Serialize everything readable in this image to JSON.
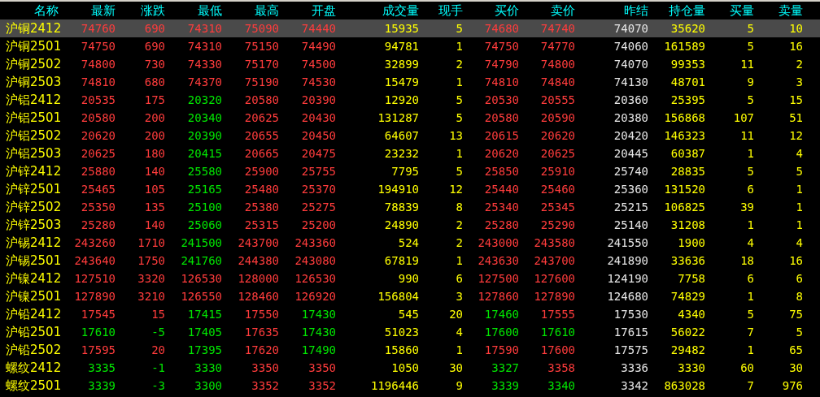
{
  "columns": [
    {
      "label": "名称",
      "kind": "name"
    },
    {
      "label": "最新",
      "kind": "price"
    },
    {
      "label": "涨跌",
      "kind": "price"
    },
    {
      "label": "最低",
      "kind": "price"
    },
    {
      "label": "最高",
      "kind": "price"
    },
    {
      "label": "开盘",
      "kind": "price"
    },
    {
      "label": "成交量",
      "kind": "volume"
    },
    {
      "label": "现手",
      "kind": "volume"
    },
    {
      "label": "买价",
      "kind": "price"
    },
    {
      "label": "卖价",
      "kind": "price"
    },
    {
      "label": "昨结",
      "kind": "ref"
    },
    {
      "label": "持仓量",
      "kind": "volume"
    },
    {
      "label": "买量",
      "kind": "volume"
    },
    {
      "label": "卖量",
      "kind": "volume"
    }
  ],
  "rows": [
    {
      "selected": true,
      "cells": [
        {
          "text": "沪铜2412"
        },
        {
          "text": "74760",
          "color": "#ff3c3c"
        },
        {
          "text": "690",
          "color": "#ff3c3c"
        },
        {
          "text": "74310",
          "color": "#ff3c3c"
        },
        {
          "text": "75090",
          "color": "#ff3c3c"
        },
        {
          "text": "74440",
          "color": "#ff3c3c"
        },
        {
          "text": "15935"
        },
        {
          "text": "5"
        },
        {
          "text": "74680",
          "color": "#ff3c3c"
        },
        {
          "text": "74740",
          "color": "#ff3c3c"
        },
        {
          "text": "74070"
        },
        {
          "text": "35620"
        },
        {
          "text": "5"
        },
        {
          "text": "10"
        }
      ]
    },
    {
      "selected": false,
      "cells": [
        {
          "text": "沪铜2501"
        },
        {
          "text": "74750",
          "color": "#ff3c3c"
        },
        {
          "text": "690",
          "color": "#ff3c3c"
        },
        {
          "text": "74310",
          "color": "#ff3c3c"
        },
        {
          "text": "75150",
          "color": "#ff3c3c"
        },
        {
          "text": "74490",
          "color": "#ff3c3c"
        },
        {
          "text": "94781"
        },
        {
          "text": "1"
        },
        {
          "text": "74750",
          "color": "#ff3c3c"
        },
        {
          "text": "74770",
          "color": "#ff3c3c"
        },
        {
          "text": "74060"
        },
        {
          "text": "161589"
        },
        {
          "text": "5"
        },
        {
          "text": "16"
        }
      ]
    },
    {
      "selected": false,
      "cells": [
        {
          "text": "沪铜2502"
        },
        {
          "text": "74800",
          "color": "#ff3c3c"
        },
        {
          "text": "730",
          "color": "#ff3c3c"
        },
        {
          "text": "74330",
          "color": "#ff3c3c"
        },
        {
          "text": "75170",
          "color": "#ff3c3c"
        },
        {
          "text": "74500",
          "color": "#ff3c3c"
        },
        {
          "text": "32899"
        },
        {
          "text": "2"
        },
        {
          "text": "74790",
          "color": "#ff3c3c"
        },
        {
          "text": "74800",
          "color": "#ff3c3c"
        },
        {
          "text": "74070"
        },
        {
          "text": "99353"
        },
        {
          "text": "11"
        },
        {
          "text": "2"
        }
      ]
    },
    {
      "selected": false,
      "cells": [
        {
          "text": "沪铜2503"
        },
        {
          "text": "74810",
          "color": "#ff3c3c"
        },
        {
          "text": "680",
          "color": "#ff3c3c"
        },
        {
          "text": "74370",
          "color": "#ff3c3c"
        },
        {
          "text": "75190",
          "color": "#ff3c3c"
        },
        {
          "text": "74530",
          "color": "#ff3c3c"
        },
        {
          "text": "15479"
        },
        {
          "text": "1"
        },
        {
          "text": "74810",
          "color": "#ff3c3c"
        },
        {
          "text": "74840",
          "color": "#ff3c3c"
        },
        {
          "text": "74130"
        },
        {
          "text": "48701"
        },
        {
          "text": "9"
        },
        {
          "text": "3"
        }
      ]
    },
    {
      "selected": false,
      "cells": [
        {
          "text": "沪铝2412"
        },
        {
          "text": "20535",
          "color": "#ff3c3c"
        },
        {
          "text": "175",
          "color": "#ff3c3c"
        },
        {
          "text": "20320",
          "color": "#00e600"
        },
        {
          "text": "20580",
          "color": "#ff3c3c"
        },
        {
          "text": "20390",
          "color": "#ff3c3c"
        },
        {
          "text": "12920"
        },
        {
          "text": "5"
        },
        {
          "text": "20530",
          "color": "#ff3c3c"
        },
        {
          "text": "20555",
          "color": "#ff3c3c"
        },
        {
          "text": "20360"
        },
        {
          "text": "25395"
        },
        {
          "text": "5"
        },
        {
          "text": "15"
        }
      ]
    },
    {
      "selected": false,
      "cells": [
        {
          "text": "沪铝2501"
        },
        {
          "text": "20580",
          "color": "#ff3c3c"
        },
        {
          "text": "200",
          "color": "#ff3c3c"
        },
        {
          "text": "20340",
          "color": "#00e600"
        },
        {
          "text": "20625",
          "color": "#ff3c3c"
        },
        {
          "text": "20430",
          "color": "#ff3c3c"
        },
        {
          "text": "131287"
        },
        {
          "text": "5"
        },
        {
          "text": "20580",
          "color": "#ff3c3c"
        },
        {
          "text": "20590",
          "color": "#ff3c3c"
        },
        {
          "text": "20380"
        },
        {
          "text": "156868"
        },
        {
          "text": "107"
        },
        {
          "text": "51"
        }
      ]
    },
    {
      "selected": false,
      "cells": [
        {
          "text": "沪铝2502"
        },
        {
          "text": "20620",
          "color": "#ff3c3c"
        },
        {
          "text": "200",
          "color": "#ff3c3c"
        },
        {
          "text": "20390",
          "color": "#00e600"
        },
        {
          "text": "20655",
          "color": "#ff3c3c"
        },
        {
          "text": "20450",
          "color": "#ff3c3c"
        },
        {
          "text": "64607"
        },
        {
          "text": "13"
        },
        {
          "text": "20615",
          "color": "#ff3c3c"
        },
        {
          "text": "20620",
          "color": "#ff3c3c"
        },
        {
          "text": "20420"
        },
        {
          "text": "146323"
        },
        {
          "text": "11"
        },
        {
          "text": "12"
        }
      ]
    },
    {
      "selected": false,
      "cells": [
        {
          "text": "沪铝2503"
        },
        {
          "text": "20625",
          "color": "#ff3c3c"
        },
        {
          "text": "180",
          "color": "#ff3c3c"
        },
        {
          "text": "20415",
          "color": "#00e600"
        },
        {
          "text": "20665",
          "color": "#ff3c3c"
        },
        {
          "text": "20475",
          "color": "#ff3c3c"
        },
        {
          "text": "23232"
        },
        {
          "text": "1"
        },
        {
          "text": "20620",
          "color": "#ff3c3c"
        },
        {
          "text": "20625",
          "color": "#ff3c3c"
        },
        {
          "text": "20445"
        },
        {
          "text": "60387"
        },
        {
          "text": "1"
        },
        {
          "text": "4"
        }
      ]
    },
    {
      "selected": false,
      "cells": [
        {
          "text": "沪锌2412"
        },
        {
          "text": "25880",
          "color": "#ff3c3c"
        },
        {
          "text": "140",
          "color": "#ff3c3c"
        },
        {
          "text": "25580",
          "color": "#00e600"
        },
        {
          "text": "25900",
          "color": "#ff3c3c"
        },
        {
          "text": "25755",
          "color": "#ff3c3c"
        },
        {
          "text": "7795"
        },
        {
          "text": "5"
        },
        {
          "text": "25850",
          "color": "#ff3c3c"
        },
        {
          "text": "25910",
          "color": "#ff3c3c"
        },
        {
          "text": "25740"
        },
        {
          "text": "28835"
        },
        {
          "text": "5"
        },
        {
          "text": "5"
        }
      ]
    },
    {
      "selected": false,
      "cells": [
        {
          "text": "沪锌2501"
        },
        {
          "text": "25465",
          "color": "#ff3c3c"
        },
        {
          "text": "105",
          "color": "#ff3c3c"
        },
        {
          "text": "25165",
          "color": "#00e600"
        },
        {
          "text": "25480",
          "color": "#ff3c3c"
        },
        {
          "text": "25370",
          "color": "#ff3c3c"
        },
        {
          "text": "194910"
        },
        {
          "text": "12"
        },
        {
          "text": "25440",
          "color": "#ff3c3c"
        },
        {
          "text": "25460",
          "color": "#ff3c3c"
        },
        {
          "text": "25360"
        },
        {
          "text": "131520"
        },
        {
          "text": "6"
        },
        {
          "text": "1"
        }
      ]
    },
    {
      "selected": false,
      "cells": [
        {
          "text": "沪锌2502"
        },
        {
          "text": "25350",
          "color": "#ff3c3c"
        },
        {
          "text": "135",
          "color": "#ff3c3c"
        },
        {
          "text": "25100",
          "color": "#00e600"
        },
        {
          "text": "25380",
          "color": "#ff3c3c"
        },
        {
          "text": "25275",
          "color": "#ff3c3c"
        },
        {
          "text": "78839"
        },
        {
          "text": "8"
        },
        {
          "text": "25340",
          "color": "#ff3c3c"
        },
        {
          "text": "25345",
          "color": "#ff3c3c"
        },
        {
          "text": "25215"
        },
        {
          "text": "106825"
        },
        {
          "text": "39"
        },
        {
          "text": "1"
        }
      ]
    },
    {
      "selected": false,
      "cells": [
        {
          "text": "沪锌2503"
        },
        {
          "text": "25280",
          "color": "#ff3c3c"
        },
        {
          "text": "140",
          "color": "#ff3c3c"
        },
        {
          "text": "25060",
          "color": "#00e600"
        },
        {
          "text": "25315",
          "color": "#ff3c3c"
        },
        {
          "text": "25200",
          "color": "#ff3c3c"
        },
        {
          "text": "24890"
        },
        {
          "text": "2"
        },
        {
          "text": "25280",
          "color": "#ff3c3c"
        },
        {
          "text": "25290",
          "color": "#ff3c3c"
        },
        {
          "text": "25140"
        },
        {
          "text": "31208"
        },
        {
          "text": "1"
        },
        {
          "text": "1"
        }
      ]
    },
    {
      "selected": false,
      "cells": [
        {
          "text": "沪锡2412"
        },
        {
          "text": "243260",
          "color": "#ff3c3c"
        },
        {
          "text": "1710",
          "color": "#ff3c3c"
        },
        {
          "text": "241500",
          "color": "#00e600"
        },
        {
          "text": "243700",
          "color": "#ff3c3c"
        },
        {
          "text": "243360",
          "color": "#ff3c3c"
        },
        {
          "text": "524"
        },
        {
          "text": "2"
        },
        {
          "text": "243000",
          "color": "#ff3c3c"
        },
        {
          "text": "243580",
          "color": "#ff3c3c"
        },
        {
          "text": "241550"
        },
        {
          "text": "1900"
        },
        {
          "text": "4"
        },
        {
          "text": "4"
        }
      ]
    },
    {
      "selected": false,
      "cells": [
        {
          "text": "沪锡2501"
        },
        {
          "text": "243640",
          "color": "#ff3c3c"
        },
        {
          "text": "1750",
          "color": "#ff3c3c"
        },
        {
          "text": "241760",
          "color": "#00e600"
        },
        {
          "text": "244380",
          "color": "#ff3c3c"
        },
        {
          "text": "243080",
          "color": "#ff3c3c"
        },
        {
          "text": "67819"
        },
        {
          "text": "1"
        },
        {
          "text": "243630",
          "color": "#ff3c3c"
        },
        {
          "text": "243700",
          "color": "#ff3c3c"
        },
        {
          "text": "241890"
        },
        {
          "text": "33636"
        },
        {
          "text": "18"
        },
        {
          "text": "16"
        }
      ]
    },
    {
      "selected": false,
      "cells": [
        {
          "text": "沪镍2412"
        },
        {
          "text": "127510",
          "color": "#ff3c3c"
        },
        {
          "text": "3320",
          "color": "#ff3c3c"
        },
        {
          "text": "126530",
          "color": "#ff3c3c"
        },
        {
          "text": "128000",
          "color": "#ff3c3c"
        },
        {
          "text": "126530",
          "color": "#ff3c3c"
        },
        {
          "text": "990"
        },
        {
          "text": "6"
        },
        {
          "text": "127500",
          "color": "#ff3c3c"
        },
        {
          "text": "127600",
          "color": "#ff3c3c"
        },
        {
          "text": "124190"
        },
        {
          "text": "7758"
        },
        {
          "text": "6"
        },
        {
          "text": "6"
        }
      ]
    },
    {
      "selected": false,
      "cells": [
        {
          "text": "沪镍2501"
        },
        {
          "text": "127890",
          "color": "#ff3c3c"
        },
        {
          "text": "3210",
          "color": "#ff3c3c"
        },
        {
          "text": "126550",
          "color": "#ff3c3c"
        },
        {
          "text": "128460",
          "color": "#ff3c3c"
        },
        {
          "text": "126920",
          "color": "#ff3c3c"
        },
        {
          "text": "156804"
        },
        {
          "text": "3"
        },
        {
          "text": "127860",
          "color": "#ff3c3c"
        },
        {
          "text": "127890",
          "color": "#ff3c3c"
        },
        {
          "text": "124680"
        },
        {
          "text": "74829"
        },
        {
          "text": "1"
        },
        {
          "text": "8"
        }
      ]
    },
    {
      "selected": false,
      "cells": [
        {
          "text": "沪铅2412"
        },
        {
          "text": "17545",
          "color": "#ff3c3c"
        },
        {
          "text": "15",
          "color": "#ff3c3c"
        },
        {
          "text": "17415",
          "color": "#00e600"
        },
        {
          "text": "17550",
          "color": "#ff3c3c"
        },
        {
          "text": "17430",
          "color": "#00e600"
        },
        {
          "text": "545"
        },
        {
          "text": "20"
        },
        {
          "text": "17460",
          "color": "#00e600"
        },
        {
          "text": "17555",
          "color": "#ff3c3c"
        },
        {
          "text": "17530"
        },
        {
          "text": "4340"
        },
        {
          "text": "5"
        },
        {
          "text": "75"
        }
      ]
    },
    {
      "selected": false,
      "cells": [
        {
          "text": "沪铅2501"
        },
        {
          "text": "17610",
          "color": "#00e600"
        },
        {
          "text": "-5",
          "color": "#00e600"
        },
        {
          "text": "17405",
          "color": "#00e600"
        },
        {
          "text": "17635",
          "color": "#ff3c3c"
        },
        {
          "text": "17430",
          "color": "#00e600"
        },
        {
          "text": "51023"
        },
        {
          "text": "4"
        },
        {
          "text": "17600",
          "color": "#00e600"
        },
        {
          "text": "17610",
          "color": "#00e600"
        },
        {
          "text": "17615"
        },
        {
          "text": "56022"
        },
        {
          "text": "7"
        },
        {
          "text": "5"
        }
      ]
    },
    {
      "selected": false,
      "cells": [
        {
          "text": "沪铅2502"
        },
        {
          "text": "17595",
          "color": "#ff3c3c"
        },
        {
          "text": "20",
          "color": "#ff3c3c"
        },
        {
          "text": "17395",
          "color": "#00e600"
        },
        {
          "text": "17620",
          "color": "#ff3c3c"
        },
        {
          "text": "17490",
          "color": "#00e600"
        },
        {
          "text": "15860"
        },
        {
          "text": "1"
        },
        {
          "text": "17590",
          "color": "#ff3c3c"
        },
        {
          "text": "17600",
          "color": "#ff3c3c"
        },
        {
          "text": "17575"
        },
        {
          "text": "29482"
        },
        {
          "text": "1"
        },
        {
          "text": "65"
        }
      ]
    },
    {
      "selected": false,
      "cells": [
        {
          "text": "螺纹2412"
        },
        {
          "text": "3335",
          "color": "#00e600"
        },
        {
          "text": "-1",
          "color": "#00e600"
        },
        {
          "text": "3330",
          "color": "#00e600"
        },
        {
          "text": "3350",
          "color": "#ff3c3c"
        },
        {
          "text": "3350",
          "color": "#ff3c3c"
        },
        {
          "text": "1050"
        },
        {
          "text": "30"
        },
        {
          "text": "3327",
          "color": "#00e600"
        },
        {
          "text": "3358",
          "color": "#ff3c3c"
        },
        {
          "text": "3336"
        },
        {
          "text": "3330"
        },
        {
          "text": "60"
        },
        {
          "text": "30"
        }
      ]
    },
    {
      "selected": false,
      "cells": [
        {
          "text": "螺纹2501"
        },
        {
          "text": "3339",
          "color": "#00e600"
        },
        {
          "text": "-3",
          "color": "#00e600"
        },
        {
          "text": "3300",
          "color": "#00e600"
        },
        {
          "text": "3352",
          "color": "#ff3c3c"
        },
        {
          "text": "3352",
          "color": "#ff3c3c"
        },
        {
          "text": "1196446"
        },
        {
          "text": "9"
        },
        {
          "text": "3339",
          "color": "#00e600"
        },
        {
          "text": "3340",
          "color": "#00e600"
        },
        {
          "text": "3342"
        },
        {
          "text": "863028"
        },
        {
          "text": "7"
        },
        {
          "text": "976"
        }
      ]
    }
  ]
}
